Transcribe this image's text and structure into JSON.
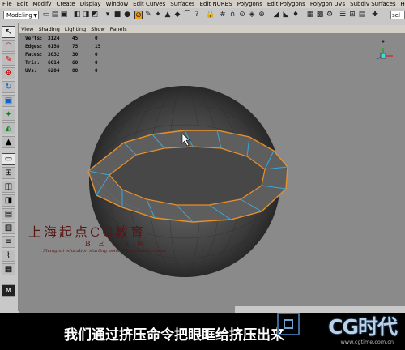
{
  "menubar": {
    "items": [
      "File",
      "Edit",
      "Modify",
      "Create",
      "Display",
      "Window",
      "Edit Curves",
      "Surfaces",
      "Edit NURBS",
      "Polygons",
      "Edit Polygons",
      "Polygon UVs",
      "Subdiv Surfaces",
      "Help"
    ]
  },
  "statusline": {
    "mode": "Modeling",
    "field_text": "sel"
  },
  "panel_menu": {
    "items": [
      "View",
      "Shading",
      "Lighting",
      "Show",
      "Panels"
    ]
  },
  "hud": {
    "rows": [
      {
        "label": "Verts:",
        "v1": "3124",
        "v2": "45",
        "v3": "0"
      },
      {
        "label": "Edges:",
        "v1": "6158",
        "v2": "75",
        "v3": "15"
      },
      {
        "label": "Faces:",
        "v1": "3032",
        "v2": "30",
        "v3": "0"
      },
      {
        "label": "Tris:",
        "v1": "6014",
        "v2": "60",
        "v3": "0"
      },
      {
        "label": "UVs:",
        "v1": "6204",
        "v2": "80",
        "v3": "0"
      }
    ]
  },
  "watermark": {
    "chinese": "上海起点CG教育",
    "latin": "BEGIN",
    "english": "Shanghai education starting point CG production base"
  },
  "subtitle": "我们通过挤压命令把眼眶给挤压出来",
  "brand": {
    "name": "CG时代",
    "url": "www.cgtime.com.cn"
  },
  "colors": {
    "viewport_bg": "#8a8a8a",
    "selected_edges": "#e8902a",
    "wire_edges": "#3aa8d8",
    "menu_bg": "#d4d0c8"
  }
}
